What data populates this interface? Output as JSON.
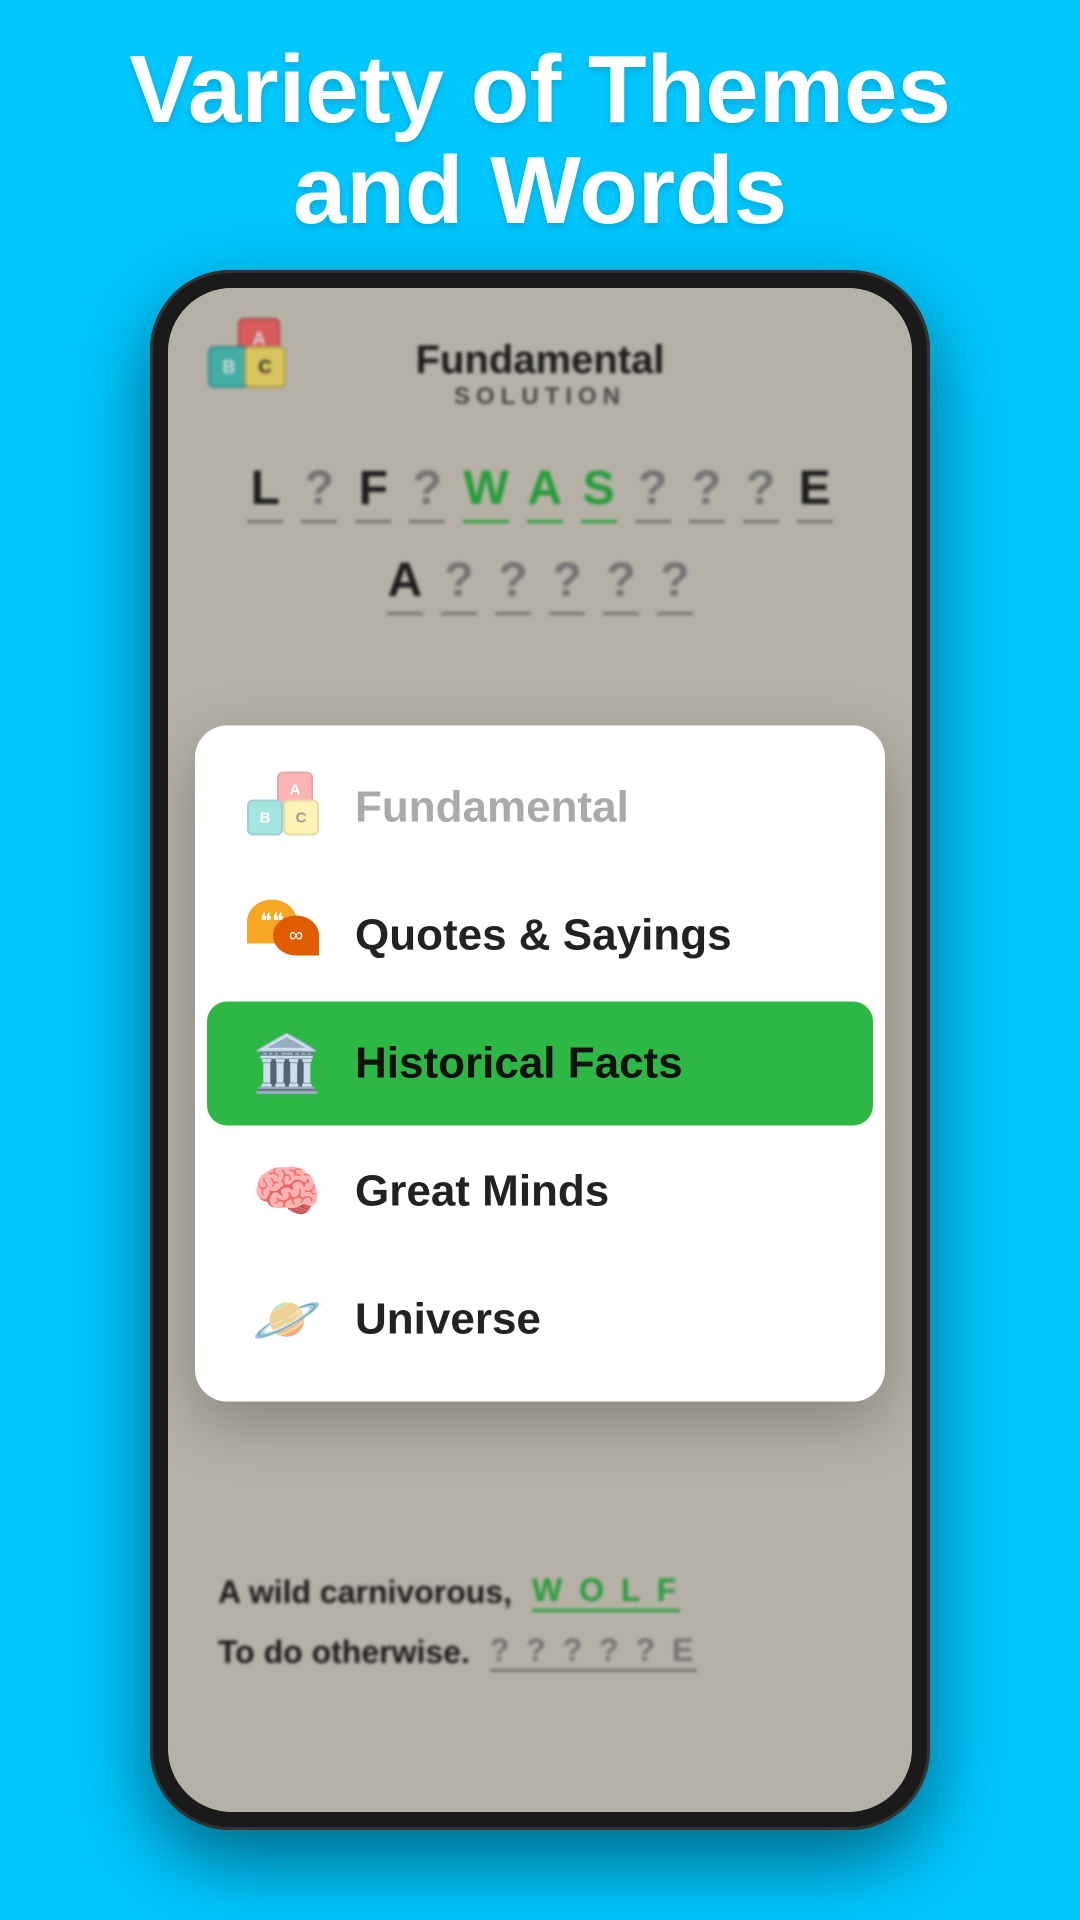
{
  "header": {
    "title_line1": "Variety of Themes",
    "title_line2": "and Words"
  },
  "game": {
    "title": "Fundamental",
    "subtitle": "SOLUTION",
    "word_row1": [
      "L",
      "?",
      "F",
      "?",
      "W",
      "A",
      "S",
      "?",
      "?",
      "?",
      "E"
    ],
    "word_row1_green": [
      4,
      5,
      6
    ],
    "word_row2": [
      "A",
      "?",
      "?",
      "?",
      "?",
      "?"
    ],
    "clues": [
      {
        "text": "A wild carnivorous,",
        "answer": "W O L F",
        "answered": true
      },
      {
        "text": "To do otherwise.",
        "answer": "? ? ? ? ? E",
        "answered": false
      }
    ]
  },
  "menu": {
    "items": [
      {
        "id": "fundamental",
        "label": "Fundamental",
        "active": false,
        "muted": true,
        "icon": "abc-blocks"
      },
      {
        "id": "quotes",
        "label": "Quotes & Sayings",
        "active": false,
        "muted": false,
        "icon": "chat-bubbles"
      },
      {
        "id": "historical",
        "label": "Historical Facts",
        "active": true,
        "muted": false,
        "icon": "historical-figure"
      },
      {
        "id": "great-minds",
        "label": "Great Minds",
        "active": false,
        "muted": false,
        "icon": "brain"
      },
      {
        "id": "universe",
        "label": "Universe",
        "active": false,
        "muted": false,
        "icon": "planet"
      }
    ]
  },
  "colors": {
    "background": "#00c8ff",
    "active_green": "#2db845",
    "text_white": "#ffffff",
    "answer_green": "#2db845"
  }
}
